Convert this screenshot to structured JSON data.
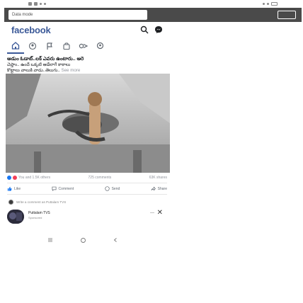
{
  "statusbar": {
    "time": "",
    "icons": [
      "settings-icon",
      "message-icon",
      "signal-icon",
      "wifi-icon",
      "battery-icon"
    ]
  },
  "datamode": {
    "label": "Data mode"
  },
  "header": {
    "logo": "facebook",
    "search_icon": "search-icon",
    "messenger_icon": "messenger-icon"
  },
  "tabs": [
    {
      "name": "home",
      "icon": "home-icon"
    },
    {
      "name": "groups",
      "icon": "groups-icon"
    },
    {
      "name": "pages",
      "icon": "pages-icon"
    },
    {
      "name": "marketplace",
      "icon": "marketplace-icon"
    },
    {
      "name": "watch",
      "icon": "watch-icon"
    },
    {
      "name": "search",
      "icon": "search-people-icon"
    }
  ],
  "post": {
    "text_line1": "ఆడుం ఓడాట్..లక్ ఎవరు ఉంటారు.. అరె",
    "text_line2": "చెప్తాం.. ఉందే ఒక్కటి ఆడేలాగే కాకాలు",
    "text_line3": "కొట్టాలు వాలుకి వాడు..తెలుగు..",
    "see_more": "See more",
    "reactions_count": "You and 1.5K others",
    "comments_count": "725 comments",
    "shares_count": "63K shares",
    "like_label": "Like",
    "comment_label": "Comment",
    "send_label": "Send",
    "share_label": "Share"
  },
  "comment_preview": {
    "text": "Write a comment as Puttalam TVS"
  },
  "notification": {
    "name": "Puttalam TVS",
    "sub": "Sponsored"
  },
  "colors": {
    "brand": "#3b5998",
    "like": "#1877f2",
    "love": "#f33e58",
    "haha": "#f7b125"
  }
}
